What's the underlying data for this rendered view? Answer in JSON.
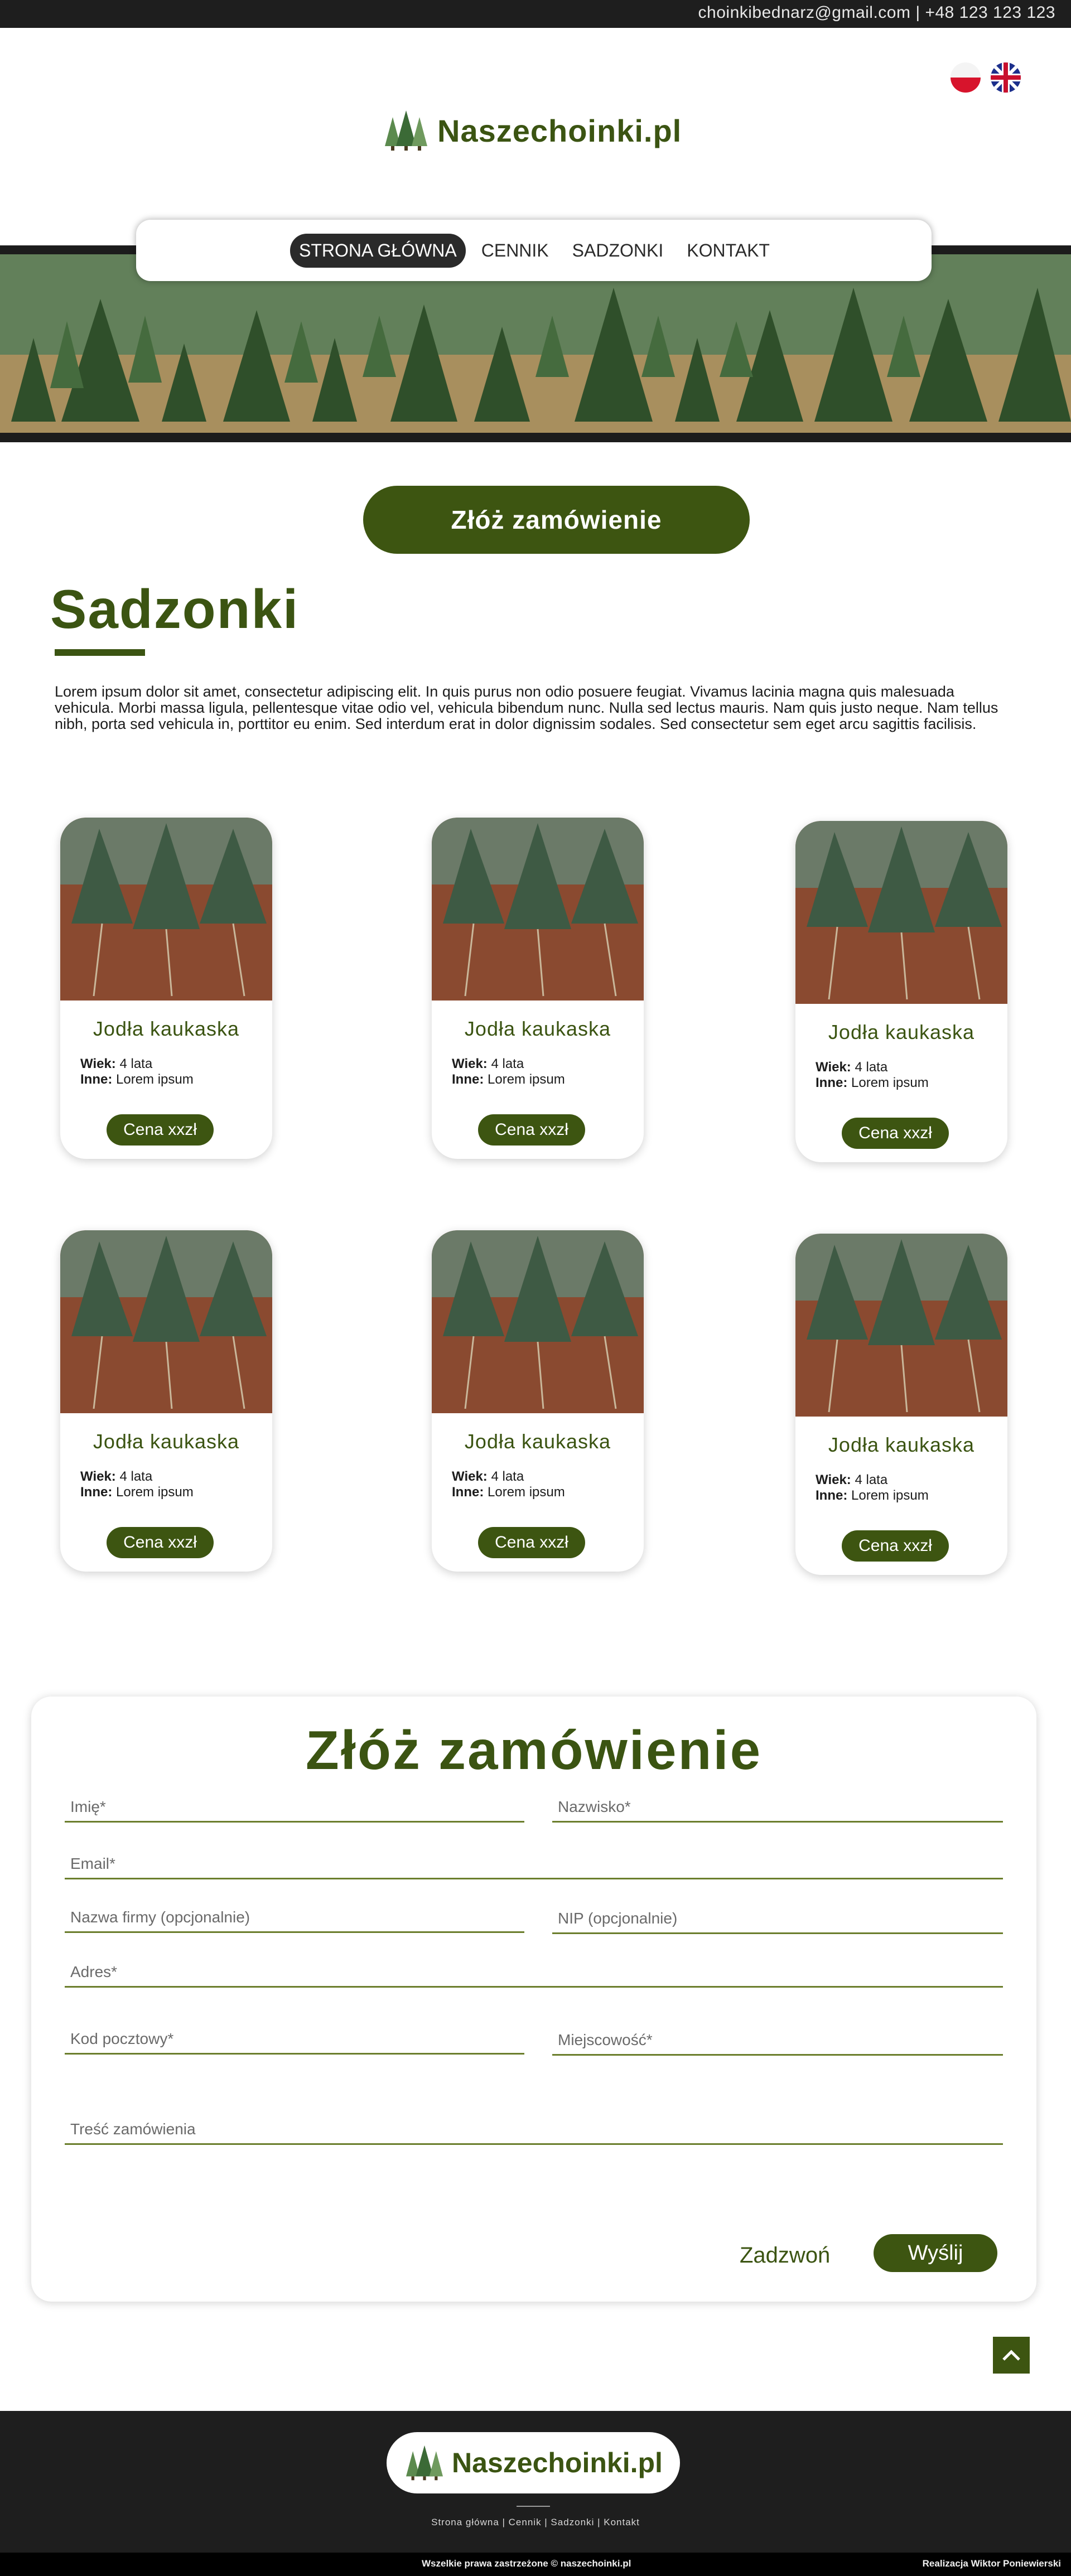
{
  "topbar": {
    "contact": "choinkibednarz@gmail.com | +48 123 123 123"
  },
  "header": {
    "languages": [
      "Polski",
      "English"
    ],
    "logo_text": "Naszechoinki.pl"
  },
  "nav": {
    "items": [
      {
        "label": "STRONA GŁÓWNA",
        "active": true
      },
      {
        "label": "CENNIK",
        "active": false
      },
      {
        "label": "SADZONKI",
        "active": false
      },
      {
        "label": "KONTAKT",
        "active": false
      }
    ]
  },
  "cta": {
    "label": "Złóż zamówienie"
  },
  "section": {
    "title": "Sadzonki",
    "intro": "Lorem ipsum dolor sit amet, consectetur adipiscing elit. In quis purus non odio posuere feugiat. Vivamus lacinia magna quis malesuada vehicula. Morbi massa ligula, pellentesque vitae odio vel, vehicula bibendum nunc. Nulla sed lectus mauris. Nam quis justo neque. Nam tellus nibh, porta sed vehicula in, porttitor eu enim. Sed interdum erat in dolor dignissim sodales. Sed consectetur sem eget arcu sagittis facilisis."
  },
  "products": [
    {
      "name": "Jodła kaukaska",
      "age_label": "Wiek:",
      "age": "4 lata",
      "other_label": "Inne:",
      "other": "Lorem ipsum",
      "price": "Cena xxzł"
    },
    {
      "name": "Jodła kaukaska",
      "age_label": "Wiek:",
      "age": "4 lata",
      "other_label": "Inne:",
      "other": "Lorem ipsum",
      "price": "Cena xxzł"
    },
    {
      "name": "Jodła kaukaska",
      "age_label": "Wiek:",
      "age": "4 lata",
      "other_label": "Inne:",
      "other": "Lorem ipsum",
      "price": "Cena xxzł"
    },
    {
      "name": "Jodła kaukaska",
      "age_label": "Wiek:",
      "age": "4 lata",
      "other_label": "Inne:",
      "other": "Lorem ipsum",
      "price": "Cena xxzł"
    },
    {
      "name": "Jodła kaukaska",
      "age_label": "Wiek:",
      "age": "4 lata",
      "other_label": "Inne:",
      "other": "Lorem ipsum",
      "price": "Cena xxzł"
    },
    {
      "name": "Jodła kaukaska",
      "age_label": "Wiek:",
      "age": "4 lata",
      "other_label": "Inne:",
      "other": "Lorem ipsum",
      "price": "Cena xxzł"
    }
  ],
  "form": {
    "title": "Złóż zamówienie",
    "fields": {
      "first_name": "Imię*",
      "last_name": "Nazwisko*",
      "email": "Email*",
      "company": "Nazwa firmy (opcjonalnie)",
      "nip": "NIP (opcjonalnie)",
      "address": "Adres*",
      "postal_code": "Kod pocztowy*",
      "city": "Miejscowość*",
      "message": "Treść zamówienia"
    },
    "call_label": "Zadzwoń",
    "send_label": "Wyślij"
  },
  "footer": {
    "logo_text": "Naszechoinki.pl",
    "links": "Strona główna | Cennik | Sadzonki | Kontakt",
    "copyright": "Wszelkie prawa zastrzeżone © naszechoinki.pl",
    "credit": "Realizacja Wiktor Poniewierski"
  },
  "colors": {
    "brand_green": "#3d5511",
    "dark": "#1e1e1e"
  },
  "icons": [
    "flag-poland-icon",
    "flag-uk-icon",
    "tree-logo-icon",
    "arrow-up-icon"
  ]
}
